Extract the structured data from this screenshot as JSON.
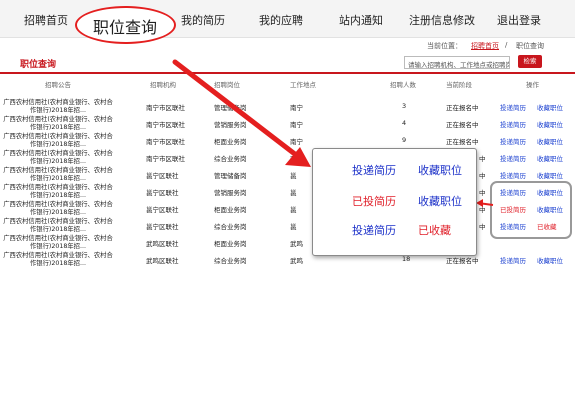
{
  "nav": {
    "items": [
      "招聘首页",
      "职位查询",
      "我的简历",
      "我的应聘",
      "站内通知",
      "注册信息修改",
      "退出登录"
    ]
  },
  "breadcrumb": {
    "prefix": "当前位置：",
    "home": "招聘首页",
    "separator": "/",
    "current": "职位查询"
  },
  "page": {
    "title": "职位查询"
  },
  "search": {
    "placeholder": "请输入招聘机构、工作地点或招聘岗位",
    "button_label": "检索"
  },
  "table": {
    "headers": [
      "招聘公告",
      "招聘机构",
      "招聘岗位",
      "工作地点",
      "招聘人数",
      "当前阶段",
      "操作"
    ],
    "rows": [
      {
        "announcement": "广西农村信用社(农村商业银行、农村合作银行)2018年招...",
        "org": "南宁市区联社",
        "position": "管理储备岗",
        "location": "南宁",
        "count": "3",
        "stage": "正在报名中",
        "action1": "投递简历",
        "action2": "收藏职位"
      },
      {
        "announcement": "广西农村信用社(农村商业银行、农村合作银行)2018年招...",
        "org": "南宁市区联社",
        "position": "营销服务岗",
        "location": "南宁",
        "count": "4",
        "stage": "正在报名中",
        "action1": "投递简历",
        "action2": "收藏职位"
      },
      {
        "announcement": "广西农村信用社(农村商业银行、农村合作银行)2018年招...",
        "org": "南宁市区联社",
        "position": "柜面业务岗",
        "location": "南宁",
        "count": "9",
        "stage": "正在报名中",
        "action1": "投递简历",
        "action2": "收藏职位"
      },
      {
        "announcement": "广西农村信用社(农村商业银行、农村合作银行)2018年招...",
        "org": "南宁市区联社",
        "position": "综合业务岗",
        "location": "南宁",
        "count": "",
        "stage": "中",
        "action1": "投递简历",
        "action2": "收藏职位"
      },
      {
        "announcement": "广西农村信用社(农村商业银行、农村合作银行)2018年招...",
        "org": "邕宁区联社",
        "position": "管理储备岗",
        "location": "邕",
        "count": "",
        "stage": "中",
        "action1": "投递简历",
        "action2": "收藏职位"
      },
      {
        "announcement": "广西农村信用社(农村商业银行、农村合作银行)2018年招...",
        "org": "邕宁区联社",
        "position": "营销服务岗",
        "location": "邕",
        "count": "",
        "stage": "中",
        "action1": "投递简历",
        "action2": "收藏职位"
      },
      {
        "announcement": "广西农村信用社(农村商业银行、农村合作银行)2018年招...",
        "org": "邕宁区联社",
        "position": "柜面业务岗",
        "location": "邕",
        "count": "",
        "stage": "中",
        "action1": "已投简历",
        "action2": "收藏职位"
      },
      {
        "announcement": "广西农村信用社(农村商业银行、农村合作银行)2018年招...",
        "org": "邕宁区联社",
        "position": "综合业务岗",
        "location": "邕",
        "count": "",
        "stage": "中",
        "action1": "投递简历",
        "action2": "已收藏"
      },
      {
        "announcement": "广西农村信用社(农村商业银行、农村合作银行)2018年招...",
        "org": "武鸣区联社",
        "position": "柜面业务岗",
        "location": "武鸣",
        "count": "",
        "stage": "",
        "action1": "",
        "action2": ""
      },
      {
        "announcement": "广西农村信用社(农村商业银行、农村合作银行)2018年招...",
        "org": "武鸣区联社",
        "position": "综合业务岗",
        "location": "武鸣",
        "count": "18",
        "stage": "正在报名中",
        "action1": "投递简历",
        "action2": "收藏职位"
      }
    ]
  },
  "popup": {
    "rows": [
      [
        "投递简历",
        "收藏职位"
      ],
      [
        "已投简历",
        "收藏职位"
      ],
      [
        "投递简历",
        "已收藏"
      ]
    ]
  },
  "colors": {
    "brand_red": "#c8161d",
    "annotation_red": "#e41f1f",
    "link_blue": "#1a2fc8"
  }
}
